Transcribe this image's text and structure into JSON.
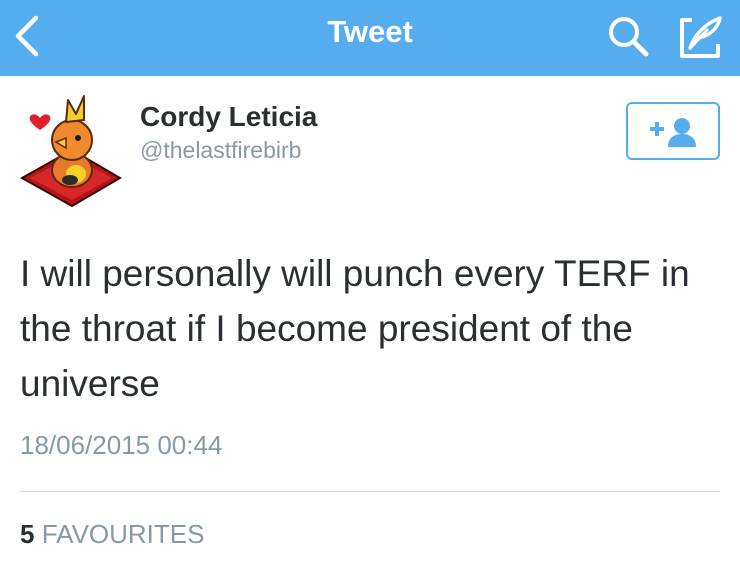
{
  "navbar": {
    "title": "Tweet",
    "back_icon": "chevron-left-icon",
    "search_icon": "search-icon",
    "compose_icon": "compose-icon",
    "background_color": "#55acee"
  },
  "author": {
    "name": "Cordy Leticia",
    "handle": "@thelastfirebirb",
    "avatar_icon": "avatar-torchic-image",
    "follow_icon": "add-user-icon"
  },
  "tweet": {
    "text": "I will personally will punch every TERF in the throat if I become president of the universe",
    "timestamp": "18/06/2015 00:44"
  },
  "stats": {
    "favourites_count": "5",
    "favourites_label": "FAVOURITES"
  }
}
